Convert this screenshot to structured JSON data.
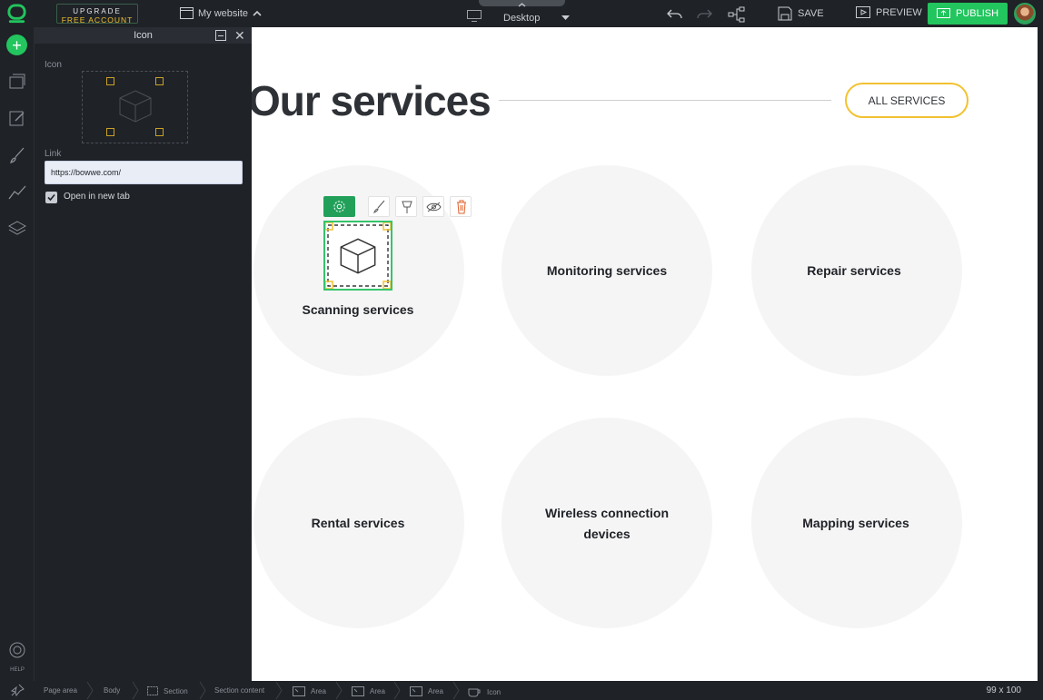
{
  "topbar": {
    "upgrade_line1": "UPGRADE",
    "upgrade_line2": "FREE ACCOUNT",
    "site_name": "My website",
    "device_label": "Desktop",
    "save_label": "SAVE",
    "preview_label": "PREVIEW",
    "publish_label": "PUBLISH"
  },
  "iconbar": {
    "help_label": "HELP"
  },
  "panel": {
    "title": "Icon",
    "icon_label": "Icon",
    "link_label": "Link",
    "link_value": "https://bowwe.com/",
    "open_new_tab_label": "Open in new tab",
    "open_new_tab_checked": true
  },
  "canvas": {
    "section_title": "Our services",
    "all_services_label": "ALL SERVICES",
    "services": [
      "Scanning services",
      "Monitoring services",
      "Repair services",
      "Rental services",
      "Wireless connection devices",
      "Mapping services"
    ]
  },
  "breadcrumbs": [
    "Page area",
    "Body",
    "Section",
    "Section content",
    "Area",
    "Area",
    "Area",
    "Icon"
  ],
  "element_size": "99 x 100",
  "colors": {
    "accent_green": "#22c55e",
    "accent_yellow": "#f2c230",
    "dark_bg": "#1f2227"
  }
}
